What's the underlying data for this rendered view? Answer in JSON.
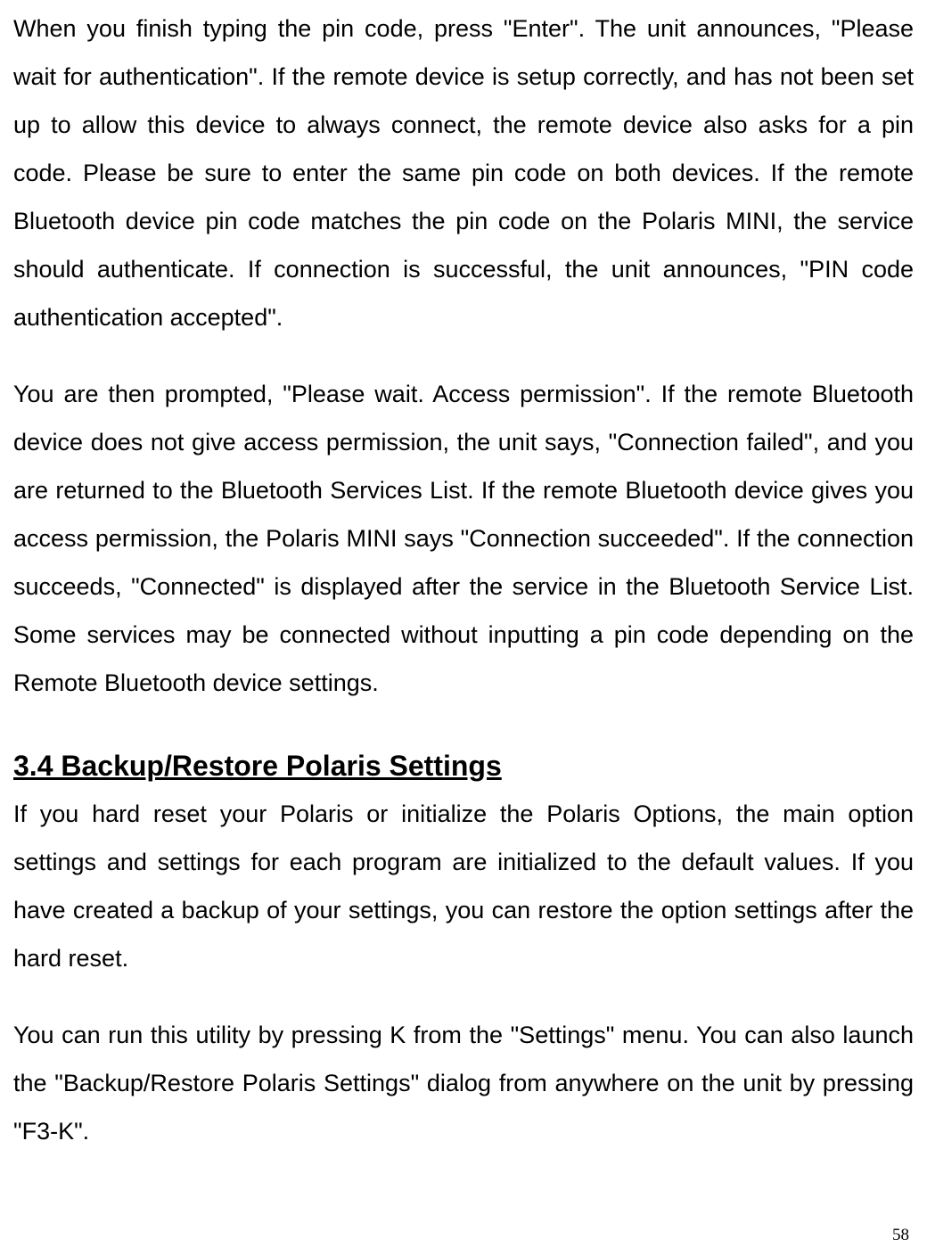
{
  "paragraphs": {
    "p1": "When you finish typing the pin code, press \"Enter\". The unit announces, \"Please wait for authentication\". If the remote device is setup correctly, and has not been set up to allow this device to always connect, the remote device also asks for a pin code. Please be sure to enter the same pin code on both devices. If the remote Bluetooth device pin code matches the pin code on the Polaris MINI, the service should authenticate. If connection is successful, the unit announces, \"PIN code authentication accepted\".",
    "p2": "You are then prompted, \"Please wait. Access permission\". If the remote Bluetooth device does not give access permission, the unit says, \"Connection failed\", and you are returned to the Bluetooth Services List. If the remote Bluetooth device gives you access permission, the Polaris MINI says \"Connection succeeded\". If the connection succeeds, \"Connected\" is displayed after the service in the Bluetooth Service List. Some services may be connected without inputting a pin code depending on the Remote Bluetooth device settings.",
    "p3": "If you hard reset your Polaris or initialize the Polaris Options, the main option settings and settings for each program are initialized to the default values. If you have created a backup of your settings, you can restore the option settings after the hard reset.",
    "p4": "You can run this utility by pressing K from the \"Settings\" menu. You can also launch the \"Backup/Restore Polaris Settings\" dialog from anywhere on the unit by pressing \"F3-K\"."
  },
  "heading": {
    "section_3_4": "3.4 Backup/Restore Polaris Settings"
  },
  "page_number": "58"
}
